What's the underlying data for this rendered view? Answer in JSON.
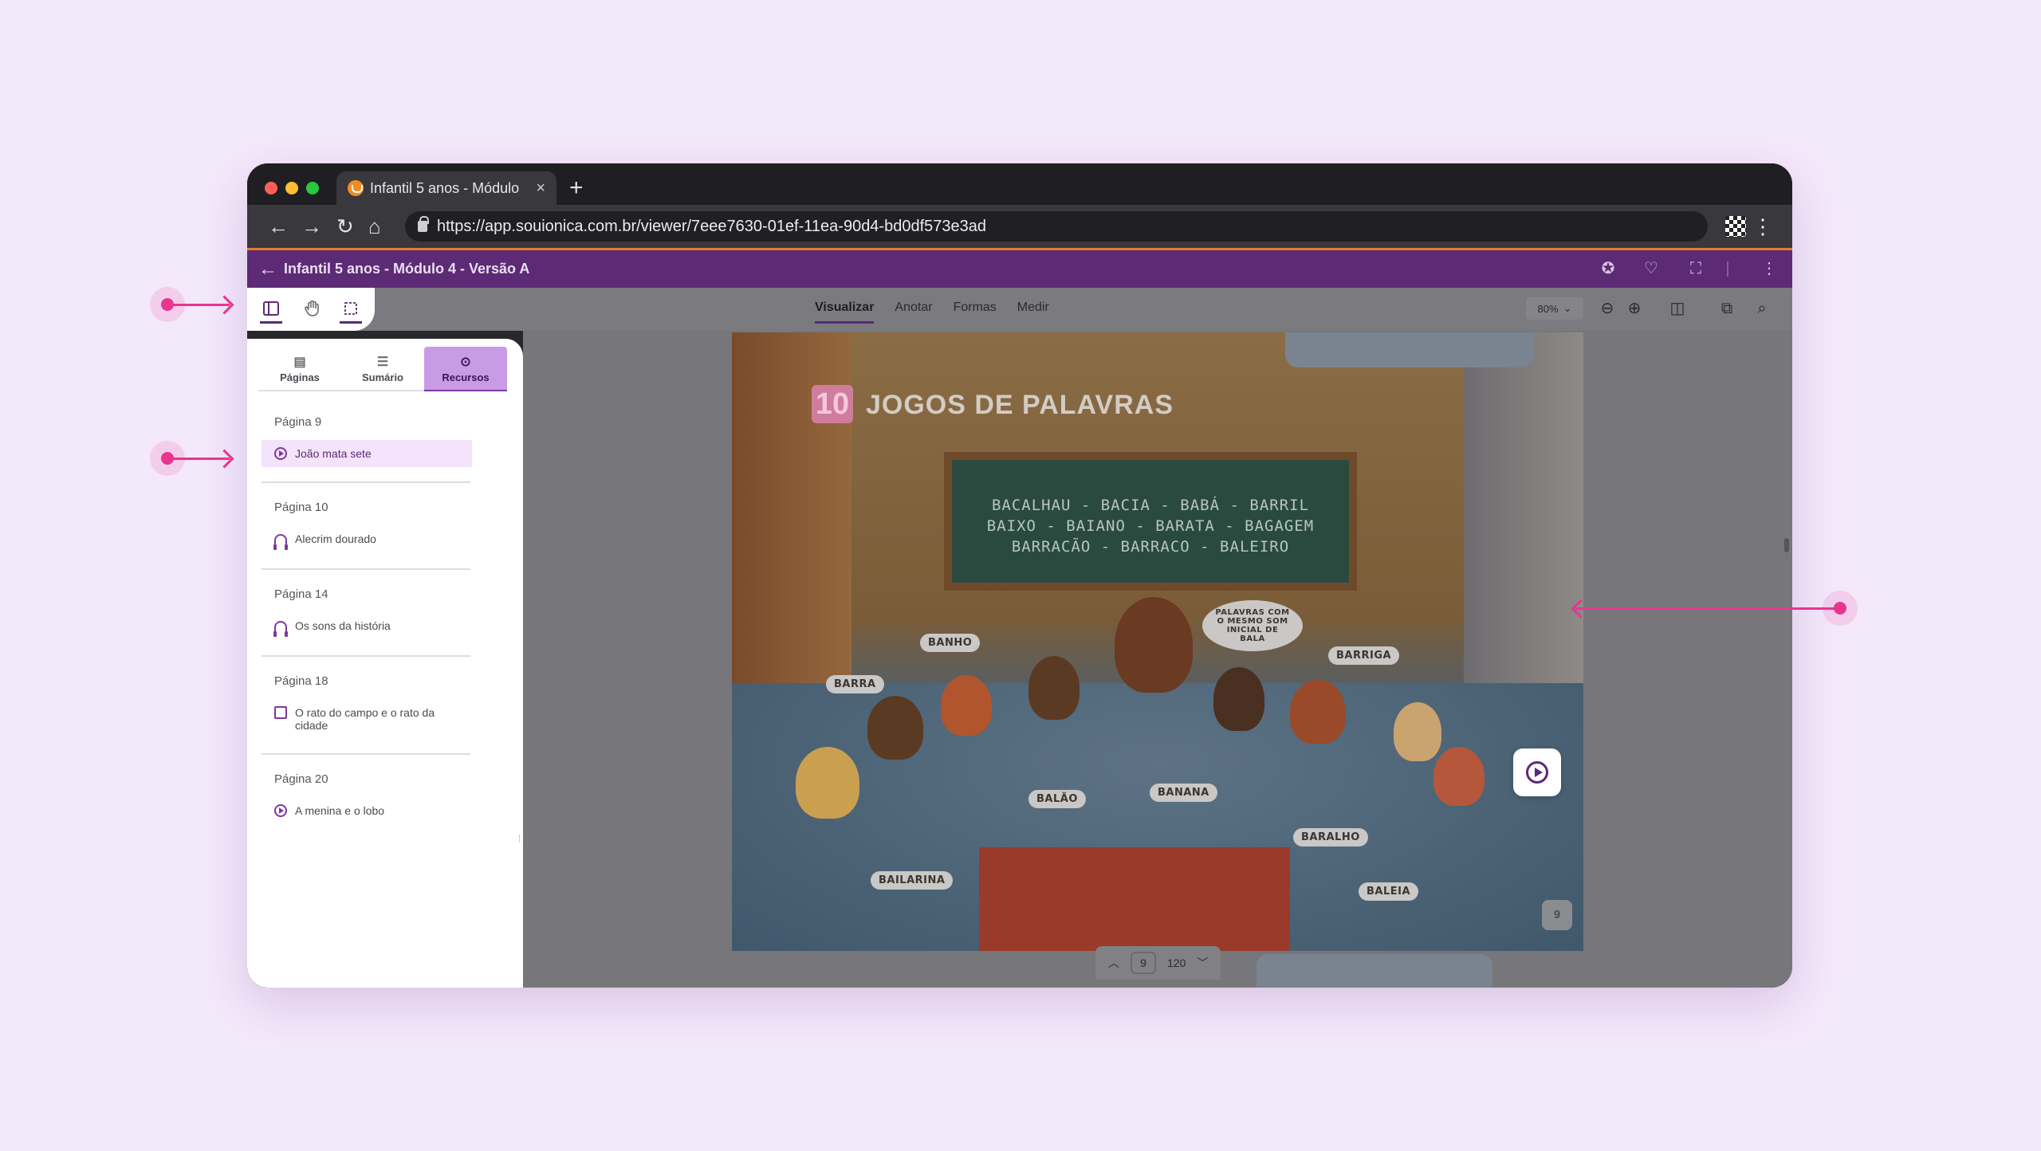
{
  "browser": {
    "tab_title": "Infantil 5 anos - Módulo",
    "tab_close": "×",
    "new_tab": "+",
    "url": "https://app.souionica.com.br/viewer/7eee7630-01ef-11ea-90d4-bd0df573e3ad"
  },
  "app": {
    "header_title": "Infantil 5 anos - Módulo 4 - Versão A",
    "modes": [
      "Visualizar",
      "Anotar",
      "Formas",
      "Medir"
    ],
    "active_mode": "Visualizar",
    "zoom": "80%",
    "accent_color": "#5d2a76",
    "highlight_color": "#c99be6"
  },
  "sidebar": {
    "tabs": [
      {
        "label": "Páginas",
        "icon": "pages-icon"
      },
      {
        "label": "Sumário",
        "icon": "list-icon"
      },
      {
        "label": "Recursos",
        "icon": "play-circle-icon"
      }
    ],
    "active_tab": "Recursos",
    "groups": [
      {
        "page": "Página 9",
        "items": [
          {
            "label": "João mata sete",
            "icon": "play-circle-icon",
            "selected": true
          }
        ]
      },
      {
        "page": "Página 10",
        "items": [
          {
            "label": "Alecrim dourado",
            "icon": "headphones-icon"
          }
        ]
      },
      {
        "page": "Página 14",
        "items": [
          {
            "label": "Os sons da história",
            "icon": "headphones-icon"
          }
        ]
      },
      {
        "page": "Página 18",
        "items": [
          {
            "label": "O rato do campo e o rato da cidade",
            "icon": "document-icon"
          }
        ]
      },
      {
        "page": "Página 20",
        "items": [
          {
            "label": "A menina e o lobo",
            "icon": "play-circle-icon"
          }
        ]
      }
    ]
  },
  "book_page": {
    "number_badge": "10",
    "title": "JOGOS DE PALAVRAS",
    "board_lines": [
      "BACALHAU - BACIA - BABÁ - BARRIL",
      "BAIXO - BAIANO - BARATA - BAGAGEM",
      "BARRACÃO - BARRACO - BALEIRO"
    ],
    "speech_bubbles": [
      "BANHO",
      "BARRA",
      "PALAVRAS COM O MESMO SOM INICIAL DE BALA",
      "BARRIGA",
      "BALÃO",
      "BANANA",
      "BARALHO",
      "BAILARINA",
      "BALEIA"
    ],
    "page_number": "9"
  },
  "pager": {
    "current_page": "9",
    "total_pages": "120"
  },
  "annotation_color": "#e8358e"
}
